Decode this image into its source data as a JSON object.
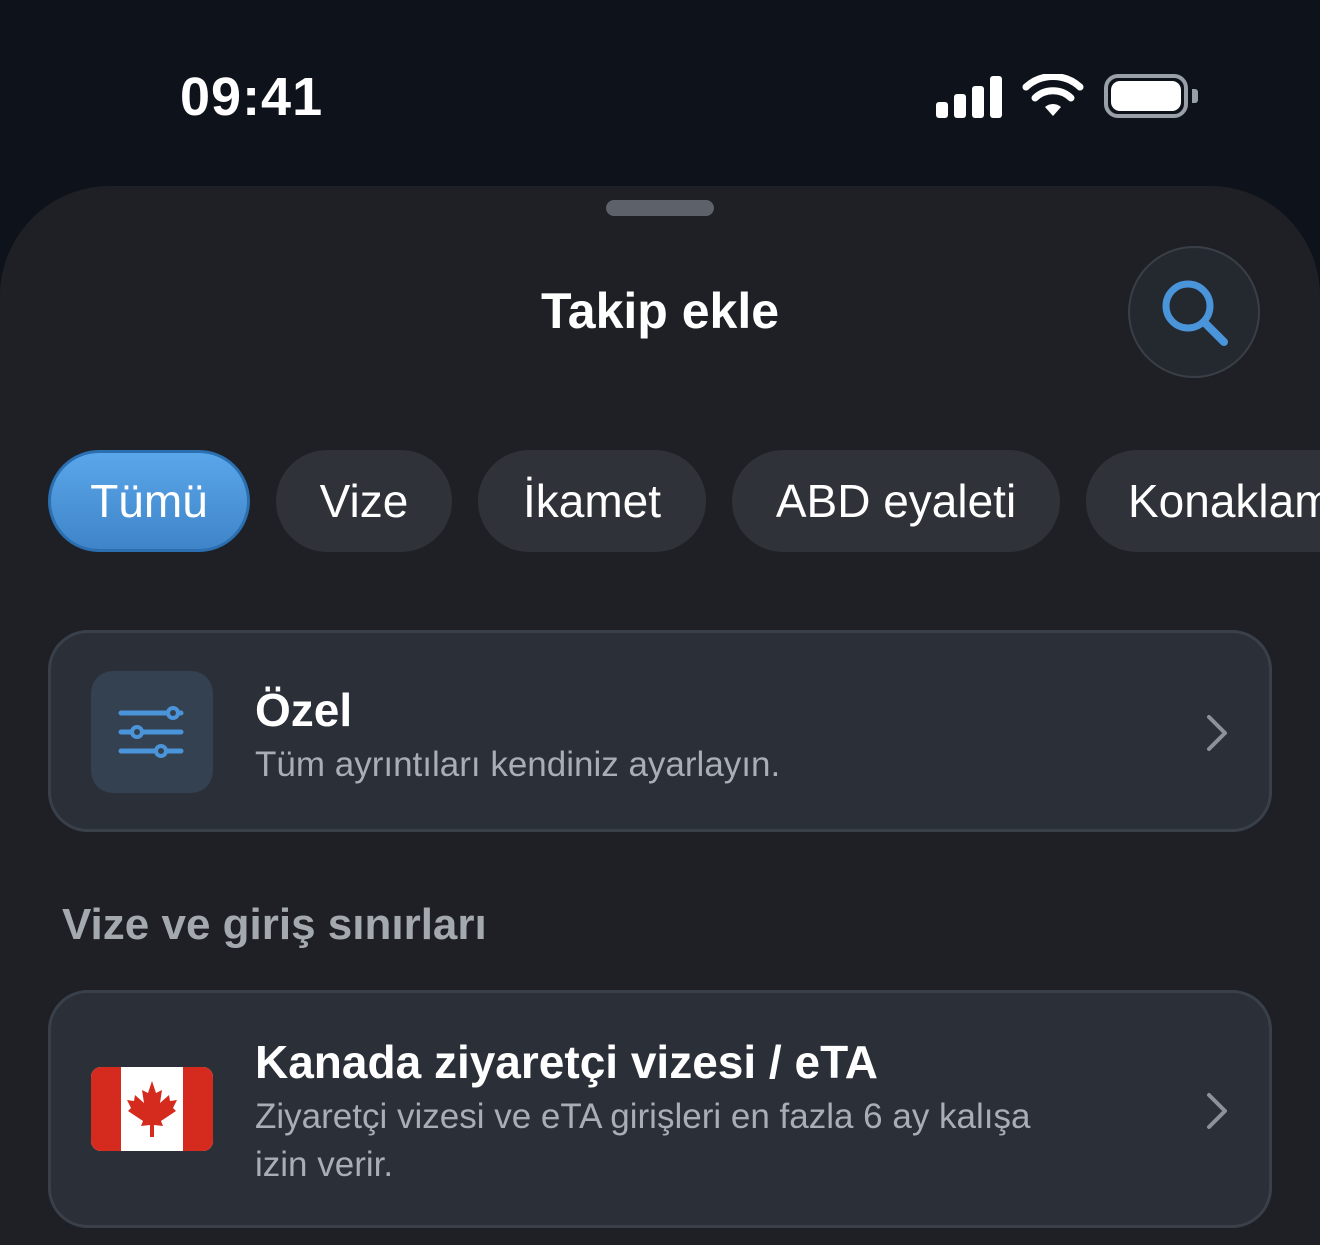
{
  "status_bar": {
    "time": "09:41"
  },
  "sheet": {
    "title": "Takip ekle",
    "search_icon": "search-icon"
  },
  "chips": [
    {
      "label": "Tümü",
      "active": true
    },
    {
      "label": "Vize",
      "active": false
    },
    {
      "label": "İkamet",
      "active": false
    },
    {
      "label": "ABD eyaleti",
      "active": false
    },
    {
      "label": "Konaklama",
      "active": false
    }
  ],
  "custom_card": {
    "title": "Özel",
    "subtitle": "Tüm ayrıntıları kendiniz ayarlayın.",
    "icon": "sliders-icon"
  },
  "section": {
    "title": "Vize ve giriş sınırları"
  },
  "visa_card": {
    "title": "Kanada ziyaretçi vizesi / eTA",
    "subtitle_line1": "Ziyaretçi vizesi ve eTA girişleri en fazla 6 ay kalışa",
    "subtitle_line2": "izin verir.",
    "icon": "canada-flag-icon"
  },
  "colors": {
    "accent": "#4a94da",
    "sheet_bg": "#1e2025",
    "card_bg": "#2a2f38"
  }
}
